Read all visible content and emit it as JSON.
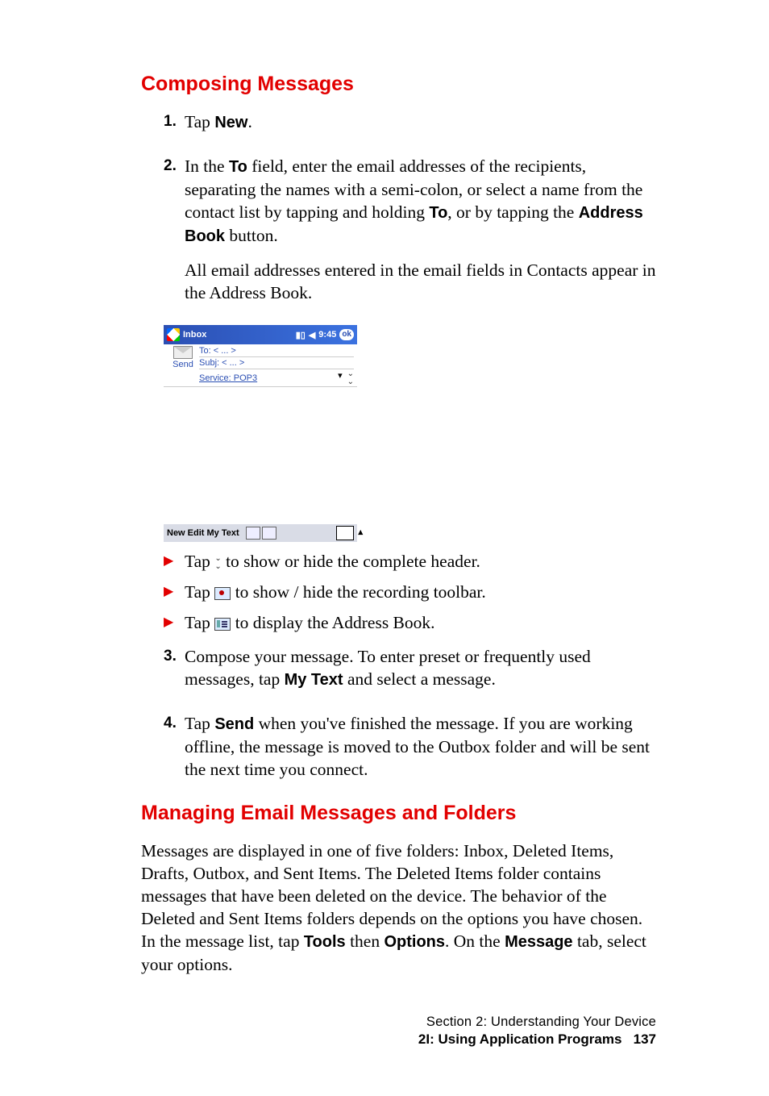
{
  "heading1": "Composing Messages",
  "steps": {
    "s1": {
      "num": "1.",
      "pre": "Tap ",
      "b1": "New",
      "post": "."
    },
    "s2": {
      "num": "2.",
      "p1_a": "In the ",
      "p1_b1": "To",
      "p1_b": " field, enter the email addresses of the recipients, separating the names with a semi-colon, or select a name from the contact list by tapping and holding ",
      "p1_b2": "To",
      "p1_c": ", or by tapping the ",
      "p1_b3": "Address Book",
      "p1_d": " button.",
      "p2": "All email addresses entered in the email fields in Contacts appear in the Address Book."
    },
    "s3": {
      "num": "3.",
      "a": "Compose your message. To enter preset or frequently used messages, tap ",
      "b": "My Text",
      "c": " and select a message."
    },
    "s4": {
      "num": "4.",
      "a": "Tap ",
      "b": "Send",
      "c": " when you've finished the message. If you are working offline, the message is moved to the Outbox folder and will be sent the next time you connect."
    }
  },
  "screenshot": {
    "title": "Inbox",
    "signal_glyph": "▮▯",
    "speaker_glyph": "◀",
    "time": "9:45",
    "ok": "ok",
    "send": "Send",
    "to": "To: < ... >",
    "subj": "Subj: < ... >",
    "service": "Service: POP3",
    "drop_glyph": "▾",
    "double_chev": "⌄",
    "menu": "New Edit My Text"
  },
  "bullets": {
    "b1_a": "Tap ",
    "b1_icon_glyph": "⌄",
    "b1_b": " to show or hide the complete header.",
    "b2_a": "Tap ",
    "b2_b": " to show / hide the recording toolbar.",
    "b3_a": "Tap ",
    "b3_b": " to display the Address Book."
  },
  "heading2": "Managing Email Messages and Folders",
  "para2": {
    "a": "Messages are displayed in one of five folders: Inbox, Deleted Items, Drafts, Outbox, and Sent Items. The Deleted Items folder contains messages that have been deleted on the device. The behavior of the Deleted and Sent Items folders depends on the options you have chosen. In the message list, tap ",
    "b1": "Tools",
    "b": " then ",
    "b2": "Options",
    "c": ". On the ",
    "b3": "Message",
    "d": " tab, select your options."
  },
  "footer": {
    "line1": "Section 2: Understanding Your Device",
    "line2_bold": "2I: Using Application Programs",
    "page": "137"
  }
}
